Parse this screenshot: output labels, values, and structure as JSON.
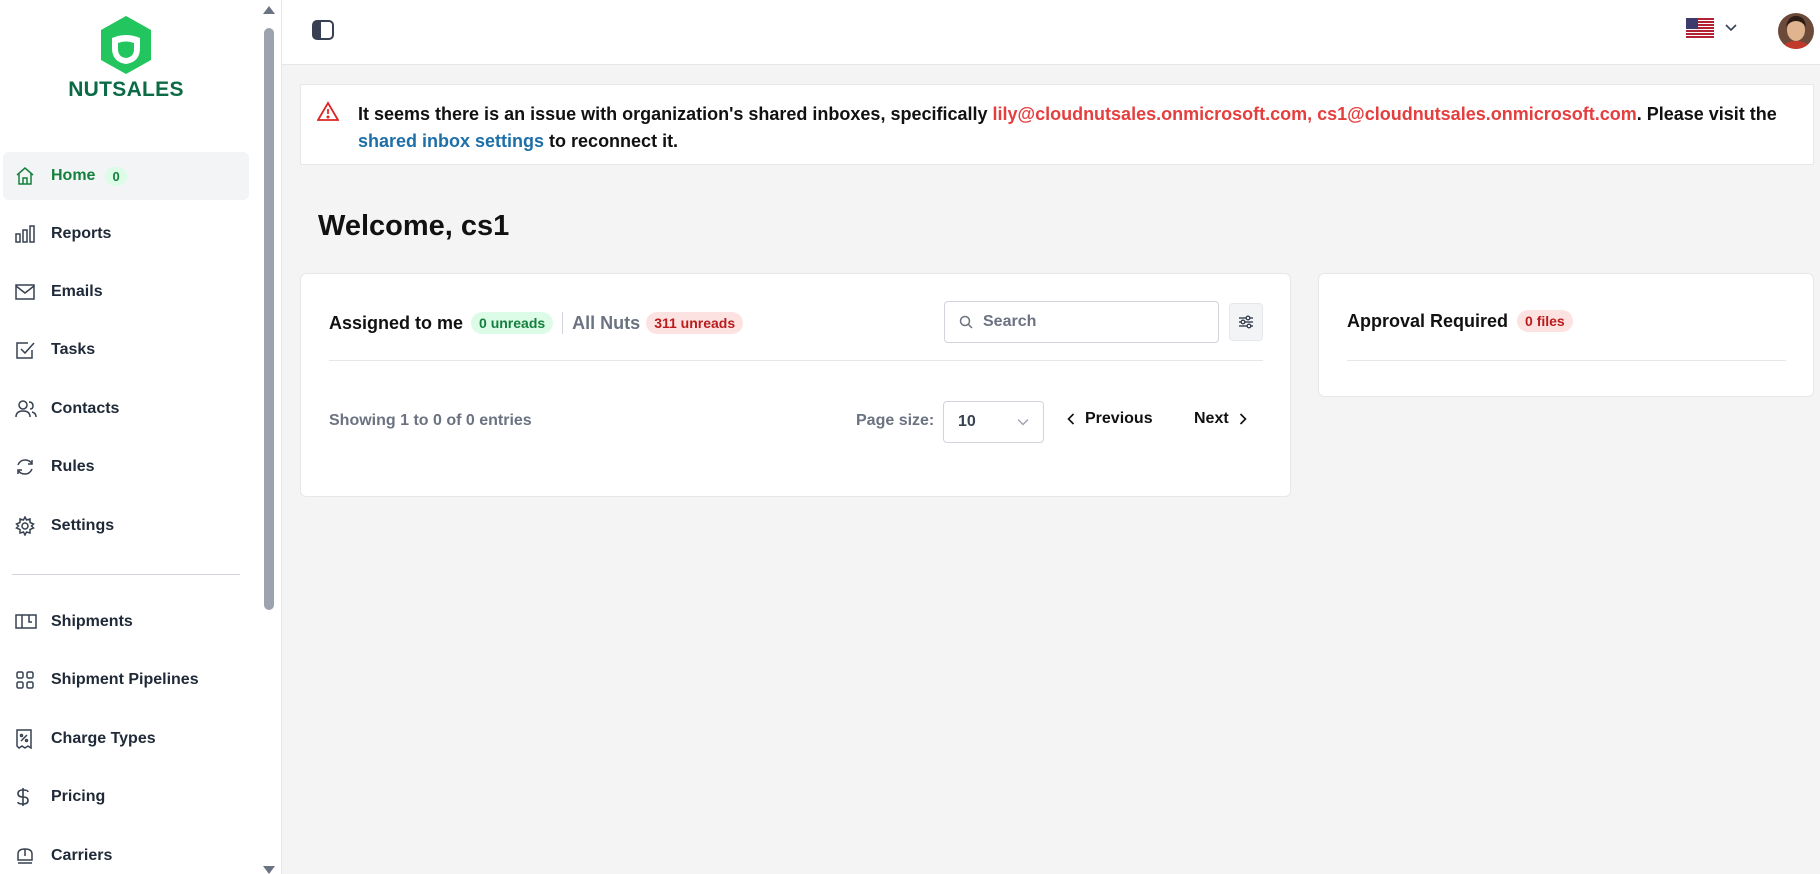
{
  "brand": {
    "name": "NUTSALES",
    "color": "#0a6b45",
    "accent": "#22c55e"
  },
  "sidebar": {
    "items": [
      {
        "label": "Home",
        "icon": "home-icon",
        "badge": "0",
        "active": true
      },
      {
        "label": "Reports",
        "icon": "bar-chart-icon"
      },
      {
        "label": "Emails",
        "icon": "mail-icon"
      },
      {
        "label": "Tasks",
        "icon": "checkbox-icon"
      },
      {
        "label": "Contacts",
        "icon": "users-icon"
      },
      {
        "label": "Rules",
        "icon": "refresh-icon"
      },
      {
        "label": "Settings",
        "icon": "gear-icon"
      },
      {
        "label": "Shipments",
        "icon": "package-icon"
      },
      {
        "label": "Shipment Pipelines",
        "icon": "grid-icon"
      },
      {
        "label": "Charge Types",
        "icon": "receipt-icon"
      },
      {
        "label": "Pricing",
        "icon": "dollar-icon"
      },
      {
        "label": "Carriers",
        "icon": "carrier-icon"
      }
    ]
  },
  "topbar": {
    "language_flag": "us-flag-icon",
    "avatar": "user-avatar"
  },
  "alert": {
    "prefix": "It seems there is an issue with organization's shared inboxes, specifically ",
    "emails": "lily@cloudnutsales.onmicrosoft.com, cs1@cloudnutsales.onmicrosoft.com",
    "middle": ". Please visit the ",
    "link": "shared inbox settings",
    "suffix": " to reconnect it."
  },
  "welcome": "Welcome, cs1",
  "assigned": {
    "tab1_label": "Assigned to me",
    "tab1_badge": "0 unreads",
    "tab2_label": "All Nuts",
    "tab2_badge": "311 unreads",
    "search_placeholder": "Search",
    "showing": "Showing 1 to 0 of 0 entries",
    "page_size_label": "Page size:",
    "page_size_value": "10",
    "previous": "Previous",
    "next": "Next"
  },
  "approval": {
    "title": "Approval Required",
    "badge": "0 files"
  }
}
